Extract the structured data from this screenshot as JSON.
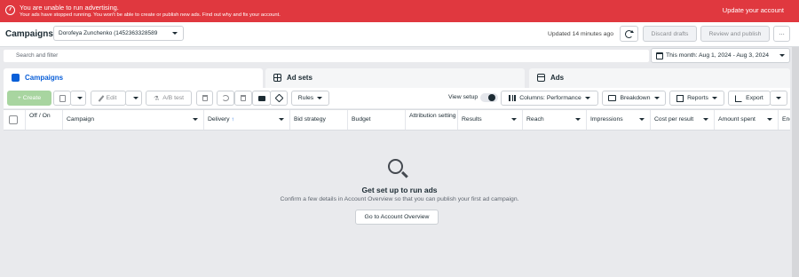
{
  "banner": {
    "title": "You are unable to run advertising.",
    "message": "Your ads have stopped running. You won't be able to create or publish new ads. Find out why and fix your account.",
    "action": "Update your account"
  },
  "header": {
    "title": "Campaigns",
    "account": "Dorofeya Zunchenko (1452363328589",
    "updated": "Updated 14 minutes ago",
    "discard": "Discard drafts",
    "review": "Review and publish",
    "more": "···"
  },
  "search": {
    "placeholder": "Search and filter"
  },
  "date_range": "This month: Aug 1, 2024 - Aug 3, 2024",
  "tabs": [
    {
      "label": "Campaigns"
    },
    {
      "label": "Ad sets"
    },
    {
      "label": "Ads"
    }
  ],
  "toolbar": {
    "create": "+ Create",
    "edit": "Edit",
    "ab_test": "A/B test",
    "rules": "Rules",
    "view_setup": "View setup",
    "columns": "Columns: Performance",
    "breakdown": "Breakdown",
    "reports": "Reports",
    "export": "Export"
  },
  "columns": [
    {
      "label": "Off / On"
    },
    {
      "label": "Campaign"
    },
    {
      "label": "Delivery"
    },
    {
      "label": "Bid strategy"
    },
    {
      "label": "Budget"
    },
    {
      "label": "Attribution setting"
    },
    {
      "label": "Results"
    },
    {
      "label": "Reach"
    },
    {
      "label": "Impressions"
    },
    {
      "label": "Cost per result"
    },
    {
      "label": "Amount spent"
    },
    {
      "label": "End"
    }
  ],
  "empty_state": {
    "title": "Get set up to run ads",
    "subtitle": "Confirm a few details in Account Overview so that you can publish your first ad campaign.",
    "button": "Go to Account Overview"
  },
  "colors": {
    "banner": "#e0383f",
    "accent": "#0a5fd8",
    "create": "#a8d5a0"
  }
}
